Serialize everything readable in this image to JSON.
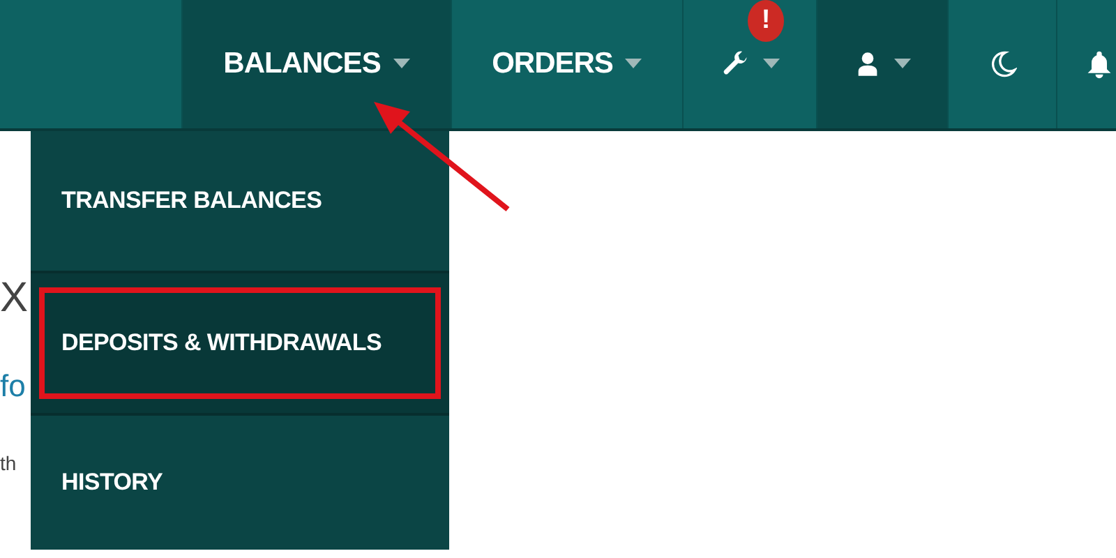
{
  "nav": {
    "items": [
      {
        "kind": "text",
        "label": "BALANCES",
        "caret": true,
        "selected": true
      },
      {
        "kind": "text",
        "label": "ORDERS",
        "caret": true,
        "selected": false
      },
      {
        "kind": "wrench",
        "badge": "!",
        "caret": true,
        "selected": false
      },
      {
        "kind": "user",
        "caret": true,
        "selected": true
      },
      {
        "kind": "moon",
        "caret": false,
        "selected": false
      },
      {
        "kind": "bell",
        "caret": false,
        "selected": false
      }
    ]
  },
  "dropdown": {
    "items": [
      {
        "label": "TRANSFER BALANCES",
        "selected": false,
        "highlighted": false
      },
      {
        "label": "DEPOSITS & WITHDRAWALS",
        "selected": true,
        "highlighted": true
      },
      {
        "label": "HISTORY",
        "selected": false,
        "highlighted": false
      }
    ]
  },
  "page": {
    "fragments": [
      {
        "kind": "heading",
        "text": "X"
      },
      {
        "kind": "link",
        "text": "fo"
      },
      {
        "kind": "body",
        "text": "th"
      }
    ]
  },
  "annotation": {
    "arrow": true
  }
}
